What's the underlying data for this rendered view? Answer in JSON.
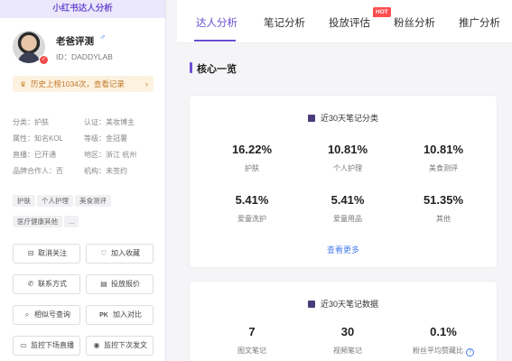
{
  "sidebar": {
    "title": "小红书达人分析",
    "profile": {
      "name": "老爸评测",
      "gender_icon": "♂",
      "id": "ID：DADDYLAB"
    },
    "history": "历史上榜1034次，查看记录",
    "attrs": [
      [
        "分类：护肤",
        "认证：美妆博主"
      ],
      [
        "属性：知名KOL",
        "等级：金冠薯"
      ],
      [
        "直播：已开通",
        "地区：浙江 杭州"
      ],
      [
        "品牌合作人：否",
        "机构：未签约"
      ]
    ],
    "tags": [
      "护肤",
      "个人护理",
      "美食测评",
      "医疗健康其他",
      "..."
    ],
    "buttons": {
      "unfollow": "取消关注",
      "favorite": "加入收藏",
      "contact": "联系方式",
      "quote": "投放报价",
      "similar": "相似号查询",
      "compare": "加入对比",
      "monitor_live": "监控下场直播",
      "monitor_post": "监控下次发文"
    }
  },
  "tabs": [
    {
      "label": "达人分析",
      "active": true
    },
    {
      "label": "笔记分析"
    },
    {
      "label": "投放评估",
      "badge": "HOT"
    },
    {
      "label": "粉丝分析"
    },
    {
      "label": "推广分析"
    }
  ],
  "section_title": "核心一览",
  "card1": {
    "title": "近30天笔记分类",
    "stats": [
      {
        "value": "16.22%",
        "label": "护肤"
      },
      {
        "value": "10.81%",
        "label": "个人护理"
      },
      {
        "value": "10.81%",
        "label": "美食测评"
      },
      {
        "value": "5.41%",
        "label": "爱童洗护"
      },
      {
        "value": "5.41%",
        "label": "爱童用品"
      },
      {
        "value": "51.35%",
        "label": "其他"
      }
    ],
    "more": "查看更多"
  },
  "card2": {
    "title": "近30天笔记数据",
    "stats": [
      {
        "value": "7",
        "label": "图文笔记"
      },
      {
        "value": "30",
        "label": "视频笔记"
      },
      {
        "value": "0.1%",
        "label": "粉丝平均赞藏比"
      }
    ]
  },
  "colors": {
    "accent": "#6b4fd1",
    "link": "#4a7ef0",
    "hot": "#ff4d4f",
    "history_bg": "#fdf1e0"
  }
}
